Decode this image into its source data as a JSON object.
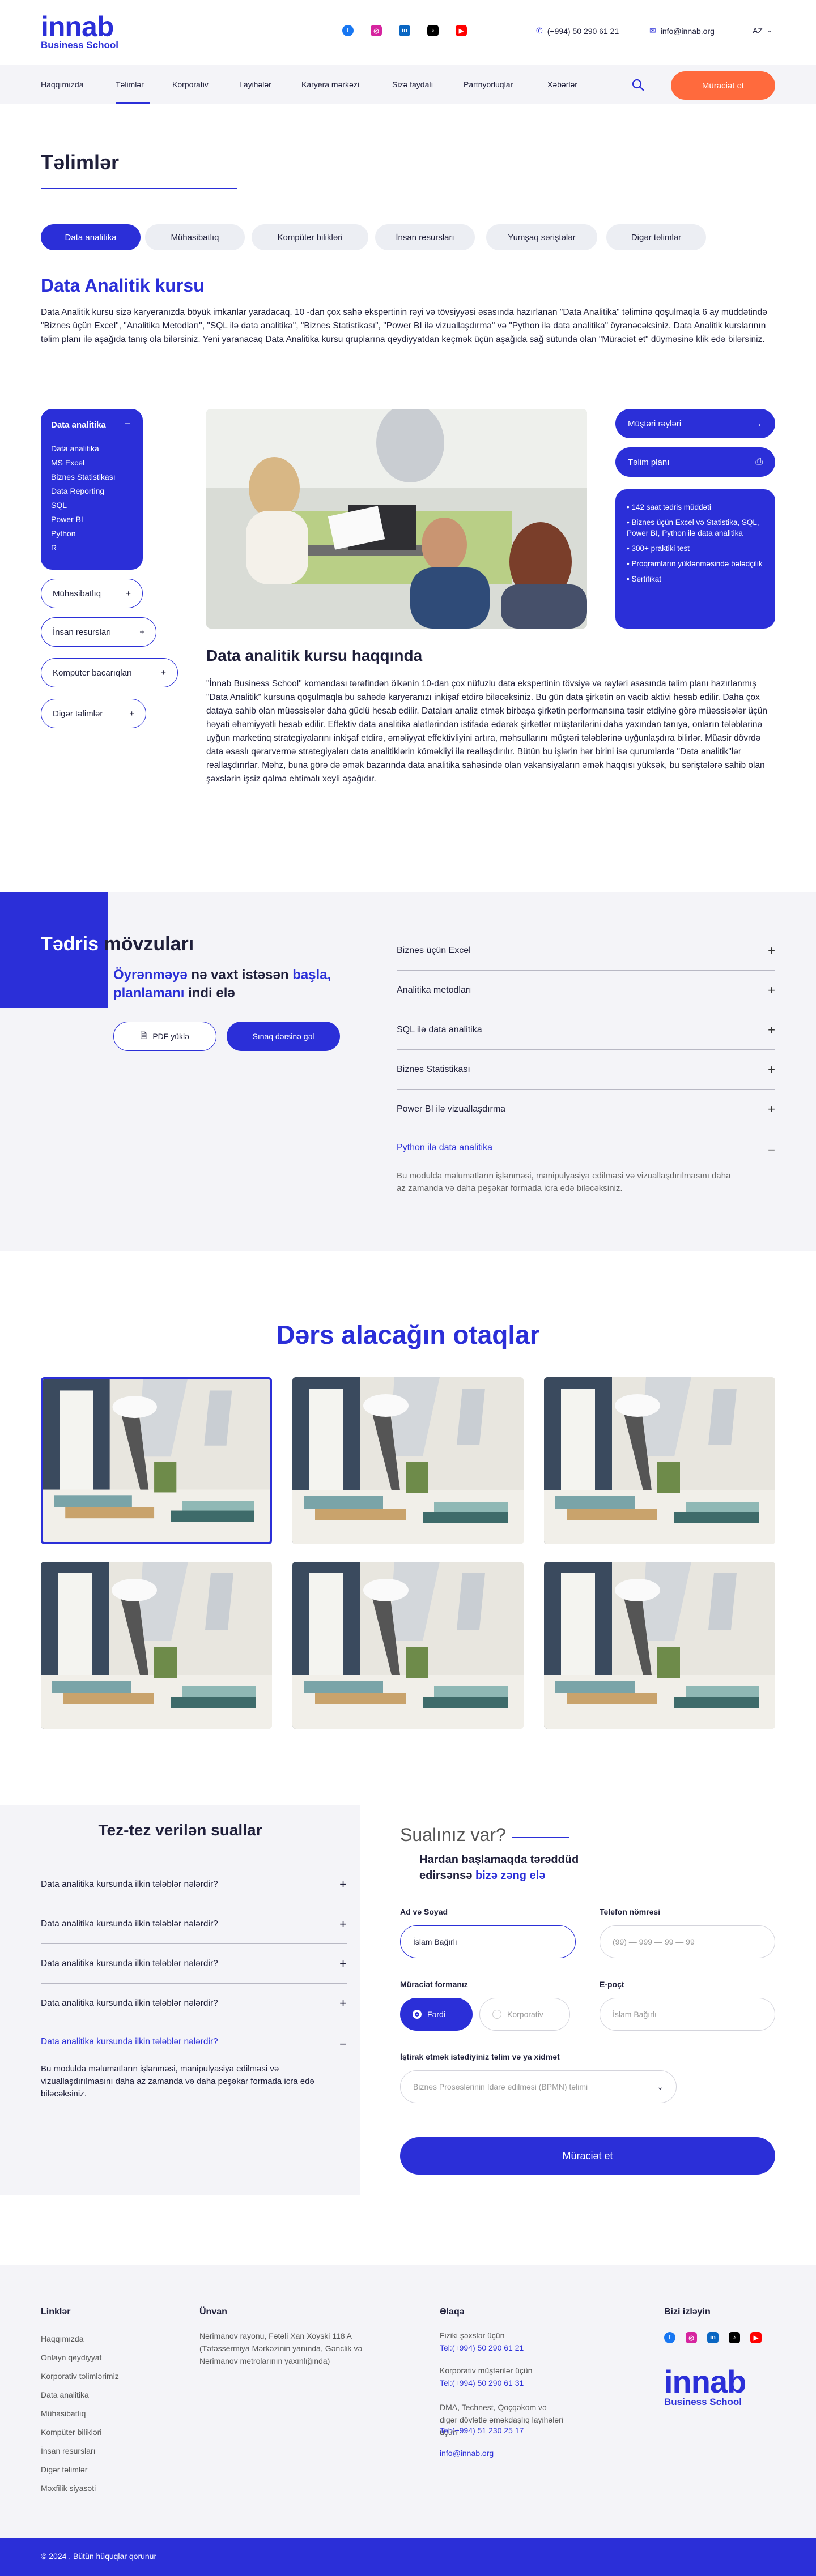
{
  "header": {
    "logo_big": "innab",
    "logo_small": "Business School",
    "phone": "(+994) 50 290 61 21",
    "email": "info@innab.org",
    "language": "AZ",
    "social": [
      "facebook-icon",
      "instagram-icon",
      "linkedin-icon",
      "tiktok-icon",
      "youtube-icon"
    ]
  },
  "nav": {
    "items": [
      "Haqqımızda",
      "Təlimlər",
      "Korporativ",
      "Layihələr",
      "Karyera mərkəzi",
      "Sizə faydalı",
      "Partnyorluqlar",
      "Xəbərlər"
    ],
    "apply_label": "Müraciət et"
  },
  "page": {
    "title": "Təlimlər",
    "categories": [
      "Data analitika",
      "Mühasibatlıq",
      "Kompüter bilikləri",
      "İnsan resursları",
      "Yumşaq səriştələr",
      "Digər təlimlər"
    ]
  },
  "course": {
    "title": "Data  Analitik kursu",
    "intro": "Data Analitik kursu sizə karyeranızda böyük imkanlar yaradacaq. 10 -dan çox sahə ekspertinin rəyi və tövsiyyəsi əsasında hazırlanan \"Data Analitika\" təliminə qoşulmaqla 6 ay müddətində  \"Biznes üçün Excel\", \"Analitika Metodları\", \"SQL ilə data analitika\", \"Biznes Statistikası\", \"Power BI ilə vizuallaşdırma\" və \"Python ilə data analitika\"  öyrənəcəksiniz. Data Analitik kurslarının təlim planı ilə aşağıda tanış ola bilərsiniz. Yeni yaranacaq Data Analitika kursu qruplarına qeydiyyatdan keçmək üçün aşağıda sağ sütunda olan \"Müraciət et\" düyməsinə klik edə bilərsiniz.",
    "about_title": "Data analitik kursu haqqında",
    "about_text": "\"İnnab Business School\" komandası tərəfindən ölkənin 10-dan çox nüfuzlu data ekspertinin tövsiyə və rəyləri əsasında təlim planı hazırlanmış \"Data Analitik\" kursuna qoşulmaqla bu sahədə karyeranızı inkişaf etdirə biləcəksiniz. Bu gün data şirkətin ən vacib aktivi hesab edilir. Daha çox dataya sahib olan müəssisələr daha güclü hesab edilir. Dataları analiz etmək birbaşa şirkətin performansına təsir etdiyinə görə müəssisələr üçün həyati əhəmiyyətli hesab edilir. Effektiv data analitika alətlərindən istifadə edərək şirkətlər müştərilərini daha yaxından tanıya, onların tələblərinə uyğun marketinq strategiyalarını inkişaf etdirə, əməliyyat effektivliyini artıra, məhsullarını müştəri tələblərinə uyğunlaşdıra bilirlər. Müasir dövrdə data əsaslı qərarvermə strategiyaları data analitiklərin köməkliyi ilə reallaşdırılır. Bütün bu işlərin hər birini isə qurumlarda \"Data analitik\"lər reallaşdırırlar. Məhz, buna görə də əmək bazarında data analitika sahəsində olan vakansiyaların əmək haqqısı yüksək, bu səriştələrə sahib olan şəxslərin işsiz qalma ehtimalı xeyli aşağıdır."
  },
  "sidebar": {
    "active_title": "Data analitika",
    "active_items": [
      "Data analitika",
      "MS Excel",
      "Biznes Statistikası",
      "Data Reporting",
      "SQL",
      "Power BI",
      "Python",
      "R"
    ],
    "groups": [
      "Mühasibatlıq",
      "İnsan resursları",
      "Kompüter bacarıqları",
      "Digər təlimlər"
    ]
  },
  "right_panel": {
    "reviews": "Müştəri rəyləri",
    "plan": "Təlim planı",
    "features": [
      "142 saat tədris müddəti",
      "Biznes üçün Excel və Statistika, SQL, Power BI, Python ilə data analitika",
      "300+ praktiki test",
      "Proqramların yüklənməsində bələdçilik",
      "Sertifikat"
    ]
  },
  "topics": {
    "title_a": "Tədris",
    "title_b": " mövzuları",
    "sub_1": "Öyrənməyə",
    "sub_2": " nə vaxt istəsən ",
    "sub_3": "başla, planlamanı",
    "sub_4": " indi elə",
    "pdf_label": "PDF yüklə",
    "trial_label": "Sınaq dərsinə gəl",
    "items": [
      "Biznes üçün Excel",
      "Analitika metodları",
      "SQL ilə data analitika",
      "Biznes Statistikası",
      "Power BI ilə vizuallaşdırma",
      "Python ilə data analitika"
    ],
    "open_text": "Bu modulda məlumatların işlənməsi, manipulyasiya edilməsi və vizuallaşdırılmasını daha az zamanda və daha peşəkar formada icra edə biləcəksiniz."
  },
  "rooms": {
    "title": "Dərs alacağın otaqlar"
  },
  "faq": {
    "title": "Tez-tez verilən suallar",
    "items": [
      "Data analitika kursunda ilkin tələblər nələrdir?",
      "Data analitika kursunda ilkin tələblər nələrdir?",
      "Data analitika kursunda ilkin tələblər nələrdir?",
      "Data analitika kursunda ilkin tələblər nələrdir?",
      "Data analitika kursunda ilkin tələblər nələrdir?"
    ],
    "open_text": "Bu modulda məlumatların işlənməsi, manipulyasiya edilməsi və vizuallaşdırılmasını daha az zamanda və daha peşəkar formada icra edə biləcəksiniz."
  },
  "form": {
    "title": "Sualınız var?",
    "sub_1": "Hardan başlamaqda tərəddüd edirsənsə ",
    "sub_2": "bizə zəng elə",
    "name_label": "Ad və Soyad",
    "name_value": "İslam Bağırlı",
    "phone_label": "Telefon nömrəsi",
    "phone_placeholder": "(99) — 999 — 99 — 99",
    "type_label": "Müraciət formanız",
    "type_personal": "Fərdi",
    "type_corporate": "Korporativ",
    "email_label": "E-poçt",
    "email_placeholder": "İslam Bağırlı",
    "training_label": "İştirak etmək istədiyiniz təlim və ya xidmət",
    "training_value": "Biznes Proseslərinin İdarə edilməsi (BPMN) təlimi",
    "submit": "Müraciət et"
  },
  "footer": {
    "links_title": "Linklər",
    "links": [
      "Haqqımızda",
      "Onlayn qeydiyyat",
      "Korporativ təlimlərimiz",
      "Data analitika",
      "Mühasibatlıq",
      "Kompüter bilikləri",
      "İnsan resursları",
      "Digər təlimlər",
      "Məxfilik siyasəti"
    ],
    "address_title": "Ünvan",
    "address": "Nərimanov rayonu, Fətəli Xan Xoyski 118 A (Təfəssermiya Mərkəzinin yanında, Gənclik və Nərimanov metrolarının yaxınlığında)",
    "contact_title": "Əlaqə",
    "contact_personal_label": "Fiziki şəxslər üçün",
    "contact_personal_phone": "Tel:(+994) 50 290 61 21",
    "contact_corp_label": "Korporativ müştərilər üçün",
    "contact_corp_phone": "Tel:(+994) 50 290 61 31",
    "contact_gov_label": "DMA, Technest, Qoçqəkom və digər dövlətlə əməkdaşlıq layihələri üçün",
    "contact_gov_phone": "Tel:(+994) 51 230 25 17",
    "contact_email": "info@innab.org",
    "follow_title": "Bizi izləyin",
    "copyright": "© 2024 . Bütün hüquqlar qorunur"
  },
  "colors": {
    "brand": "#2b2fd8",
    "accent": "#ff6a3d",
    "light": "#f4f4f8"
  }
}
